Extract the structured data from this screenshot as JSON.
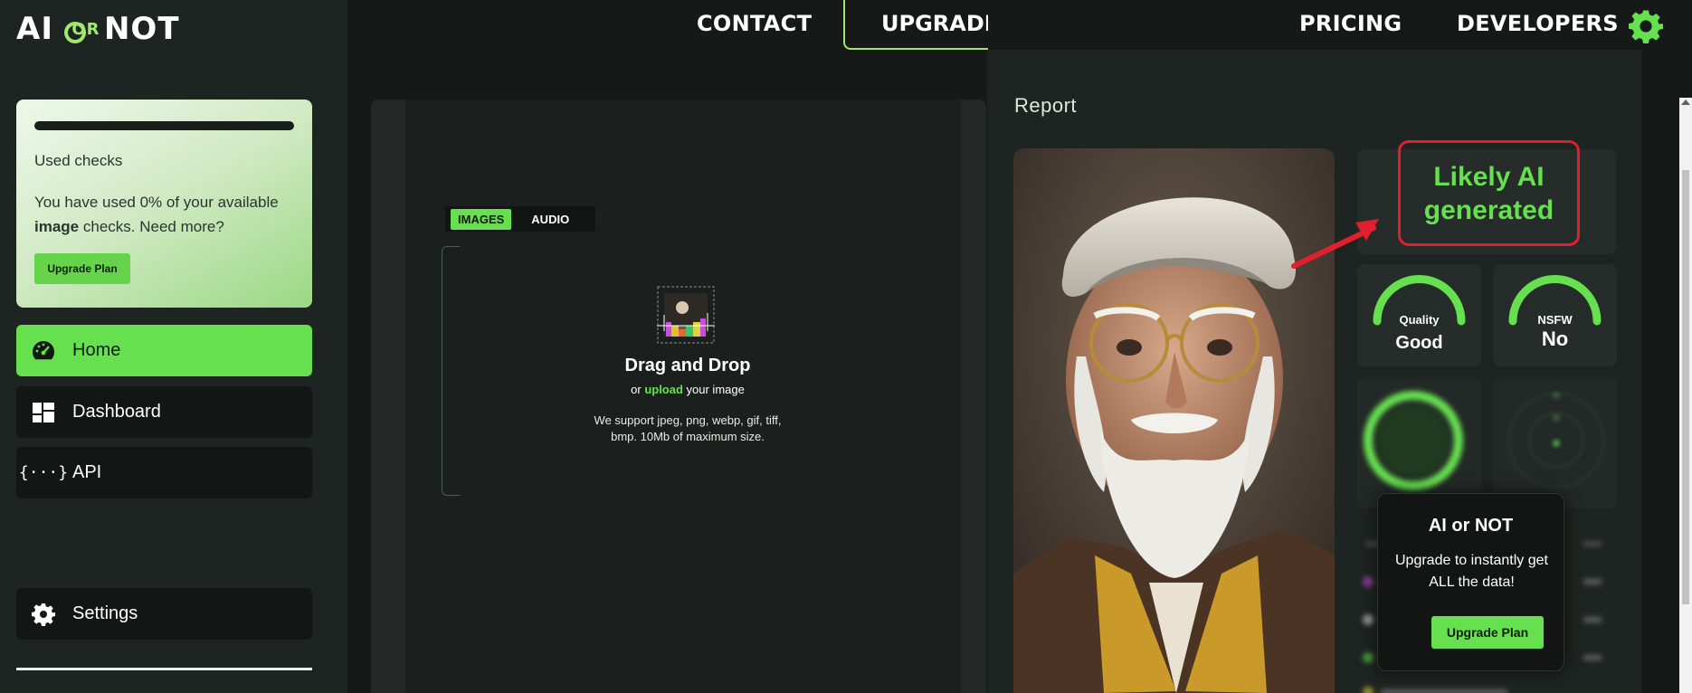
{
  "logo": {
    "left": "AI",
    "or": "OR",
    "right": "NOT"
  },
  "topnav": {
    "contact": "CONTACT",
    "upgrade": "UPGRADE",
    "pricing": "PRICING",
    "developers": "DEVELOPERS"
  },
  "checks": {
    "progress_fraction": 0,
    "title": "Used checks",
    "text_before": "You have used 0% of your available ",
    "text_bold": "image",
    "text_after": " checks. Need more?",
    "button": "Upgrade Plan"
  },
  "sidebar": {
    "items": [
      {
        "label": "Home",
        "icon": "speedometer-icon",
        "active": true
      },
      {
        "label": "Dashboard",
        "icon": "dashboard-icon"
      },
      {
        "label": "API",
        "icon": "code-braces-icon"
      },
      {
        "label": "Settings",
        "icon": "gear-icon"
      }
    ]
  },
  "upload": {
    "tabs": [
      "IMAGES",
      "AUDIO"
    ],
    "active_tab": "IMAGES",
    "title": "Drag and Drop",
    "sub_prefix": "or ",
    "sub_link": "upload",
    "sub_suffix": " your image",
    "support": "We support jpeg, png, webp, gif, tiff, bmp. 10Mb of maximum size."
  },
  "report": {
    "label": "Report",
    "verdict": "Likely AI generated",
    "quality_label": "Quality",
    "quality_value": "Good",
    "nsfw_label": "NSFW",
    "nsfw_value": "No"
  },
  "upsell": {
    "title": "AI or NOT",
    "text": "Upgrade to instantly get ALL the data!",
    "button": "Upgrade Plan"
  },
  "colors": {
    "accent": "#66e04f",
    "red": "#e0202e",
    "bg": "#161918"
  }
}
